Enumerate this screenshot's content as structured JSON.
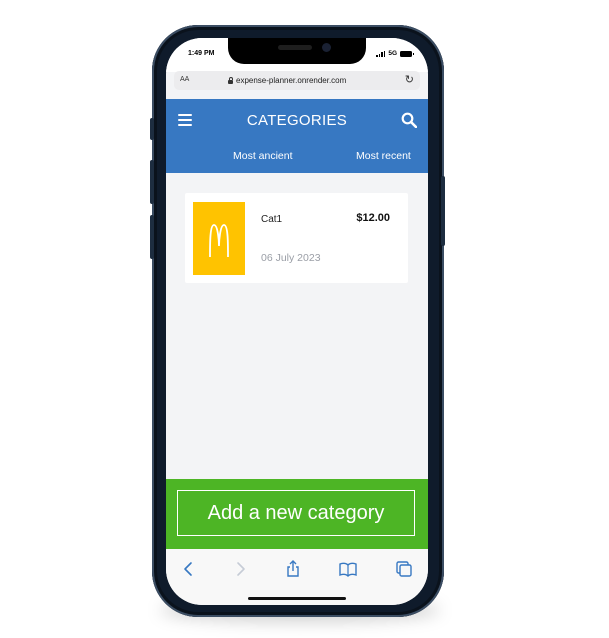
{
  "status_bar": {
    "time": "1:49 PM",
    "network": "5G"
  },
  "browser": {
    "text_size_label": "AA",
    "url": "expense-planner.onrender.com"
  },
  "header": {
    "title": "CATEGORIES",
    "sort_ancient": "Most ancient",
    "sort_recent": "Most recent"
  },
  "categories": [
    {
      "name": "Cat1",
      "amount": "$12.00",
      "date": "06 July 2023",
      "icon": "mcdonalds-logo",
      "icon_bg": "#ffc300"
    }
  ],
  "footer": {
    "add_label": "Add a new category"
  },
  "colors": {
    "header": "#3778c2",
    "footer": "#4db525",
    "accent_icon": "#3778c2"
  },
  "toolbar_icons": [
    "back-icon",
    "forward-icon",
    "share-icon",
    "bookmarks-icon",
    "tabs-icon"
  ]
}
